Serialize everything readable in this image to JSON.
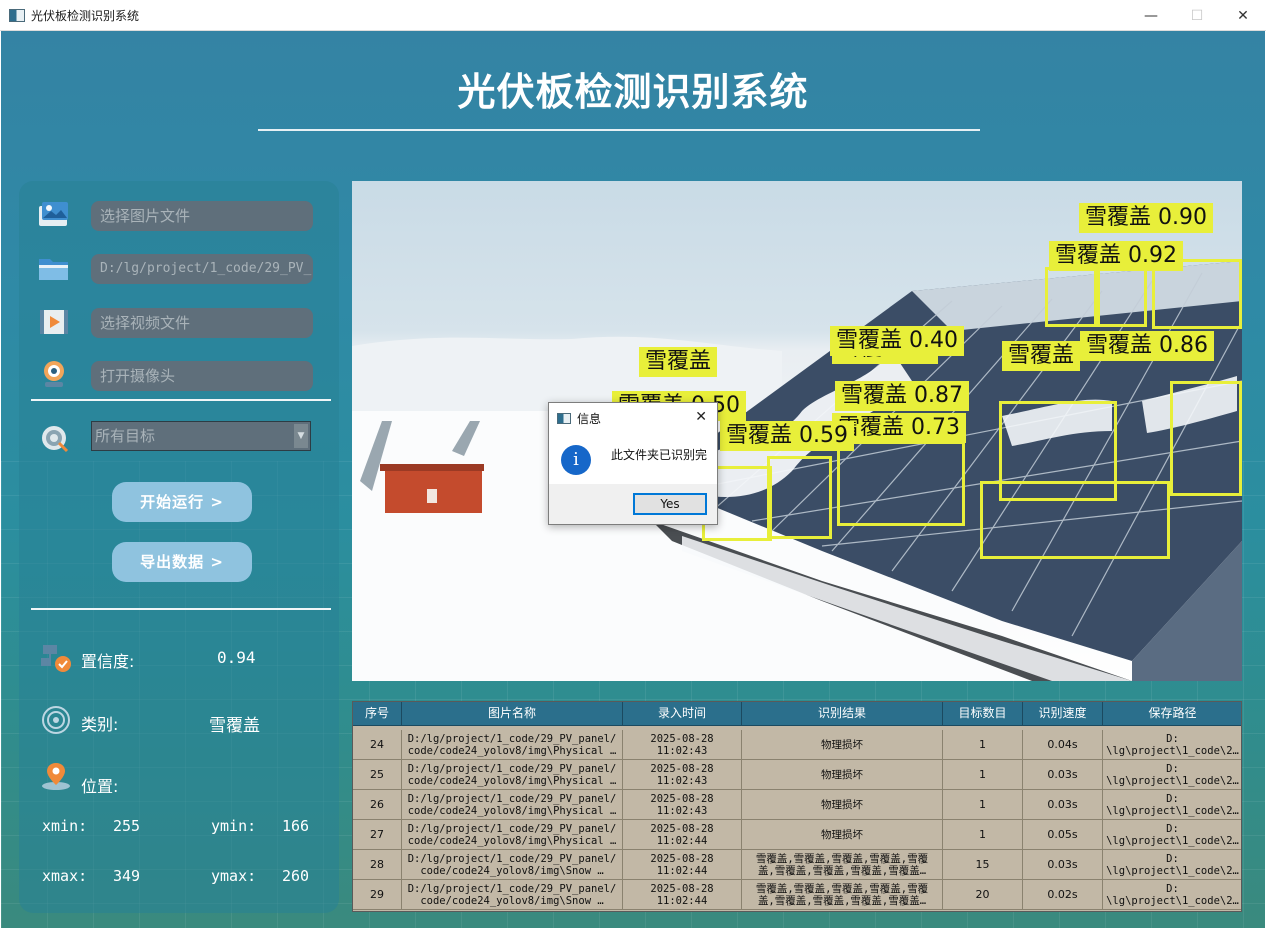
{
  "window": {
    "title": "光伏板检测识别系统",
    "minimize_glyph": "—",
    "maximize_glyph": "☐",
    "close_glyph": "✕"
  },
  "header": {
    "title": "光伏板检测识别系统"
  },
  "left_panel": {
    "image_input_placeholder": "选择图片文件",
    "folder_input_value": "D:/lg/project/1_code/29_PV_",
    "video_input_placeholder": "选择视频文件",
    "camera_input_placeholder": "打开摄像头",
    "target_select_value": "所有目标",
    "start_button": "开始运行 >",
    "export_button": "导出数据 >",
    "confidence_label": "置信度:",
    "confidence_value": "0.94",
    "class_label": "类别:",
    "class_value": "雪覆盖",
    "position_label": "位置:",
    "xmin_label": "xmin:",
    "xmin_value": "255",
    "ymin_label": "ymin:",
    "ymin_value": "166",
    "xmax_label": "xmax:",
    "xmax_value": "349",
    "ymax_label": "ymax:",
    "ymax_value": "260"
  },
  "detections": [
    "雪覆盖 0.90",
    "雪覆盖 0.92",
    "雪覆盖 0.40",
    "雪覆盖",
    "雪覆盖 0.86",
    "雪覆盖",
    "雪覆盖 0.",
    "雪覆盖 0.73",
    "雪覆盖 0.87",
    "雪覆盖 0.50",
    "雪覆盖 0.59"
  ],
  "dialog": {
    "title": "信息",
    "message": "此文件夹已识别完",
    "yes_button": "Yes",
    "close_glyph": "✕",
    "info_glyph": "i"
  },
  "table": {
    "headers": [
      "序号",
      "图片名称",
      "录入时间",
      "识别结果",
      "目标数目",
      "识别速度",
      "保存路径"
    ],
    "rows": [
      [
        "24",
        "D:/lg/project/1_code/29_PV_panel/\ncode/code24_yolov8/img\\Physical …",
        "2025-08-28\n11:02:43",
        "物理损坏",
        "1",
        "0.04s",
        "D:\n\\lg\\project\\1_code\\2…"
      ],
      [
        "25",
        "D:/lg/project/1_code/29_PV_panel/\ncode/code24_yolov8/img\\Physical …",
        "2025-08-28\n11:02:43",
        "物理损坏",
        "1",
        "0.03s",
        "D:\n\\lg\\project\\1_code\\2…"
      ],
      [
        "26",
        "D:/lg/project/1_code/29_PV_panel/\ncode/code24_yolov8/img\\Physical …",
        "2025-08-28\n11:02:43",
        "物理损坏",
        "1",
        "0.03s",
        "D:\n\\lg\\project\\1_code\\2…"
      ],
      [
        "27",
        "D:/lg/project/1_code/29_PV_panel/\ncode/code24_yolov8/img\\Physical …",
        "2025-08-28\n11:02:44",
        "物理损坏",
        "1",
        "0.05s",
        "D:\n\\lg\\project\\1_code\\2…"
      ],
      [
        "28",
        "D:/lg/project/1_code/29_PV_panel/\ncode/code24_yolov8/img\\Snow …",
        "2025-08-28\n11:02:44",
        "雪覆盖,雪覆盖,雪覆盖,雪覆盖,雪覆\n盖,雪覆盖,雪覆盖,雪覆盖,雪覆盖…",
        "15",
        "0.03s",
        "D:\n\\lg\\project\\1_code\\2…"
      ],
      [
        "29",
        "D:/lg/project/1_code/29_PV_panel/\ncode/code24_yolov8/img\\Snow …",
        "2025-08-28\n11:02:44",
        "雪覆盖,雪覆盖,雪覆盖,雪覆盖,雪覆\n盖,雪覆盖,雪覆盖,雪覆盖,雪覆盖…",
        "20",
        "0.02s",
        "D:\n\\lg\\project\\1_code\\2…"
      ]
    ]
  },
  "colors": {
    "accent_button": "#8fc3df",
    "detection_yellow": "#e8ef3a",
    "table_header": "#2b6f8c",
    "table_body": "#c2b8a6"
  }
}
